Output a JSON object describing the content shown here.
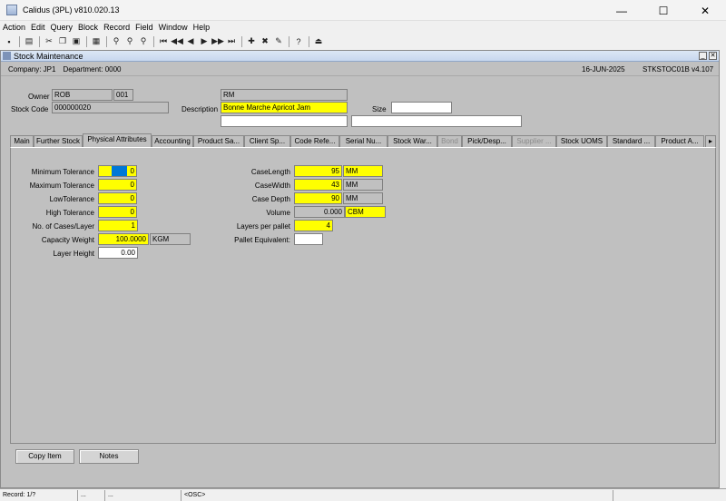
{
  "window": {
    "title": "Calidus (3PL) v810.020.13",
    "minimize": "—",
    "maximize": "☐",
    "close": "✕"
  },
  "menu": [
    "Action",
    "Edit",
    "Query",
    "Block",
    "Record",
    "Field",
    "Window",
    "Help"
  ],
  "form": {
    "title": "Stock Maintenance",
    "company": "Company: JP1",
    "department": "Department: 0000",
    "date": "16-JUN-2025",
    "form_code": "STKSTOC01B  v4.107"
  },
  "header": {
    "owner_label": "Owner",
    "owner_name": "ROB",
    "owner_code": "001",
    "stock_code_label": "Stock Code",
    "stock_code": "000000020",
    "rm": "RM",
    "description_label": "Description",
    "description": "Bonne Marche Apricot Jam",
    "size_label": "Size",
    "size": ""
  },
  "tabs": [
    {
      "label": "Main",
      "state": "normal"
    },
    {
      "label": "Further Stock",
      "state": "normal"
    },
    {
      "label": "Physical Attributes",
      "state": "active"
    },
    {
      "label": "Accounting",
      "state": "normal"
    },
    {
      "label": "Product Sa...",
      "state": "normal"
    },
    {
      "label": "Client Sp...",
      "state": "normal"
    },
    {
      "label": "Code Refe...",
      "state": "normal"
    },
    {
      "label": "Serial Nu...",
      "state": "normal"
    },
    {
      "label": "Stock War...",
      "state": "normal"
    },
    {
      "label": "Bond",
      "state": "disabled"
    },
    {
      "label": "Pick/Desp...",
      "state": "normal"
    },
    {
      "label": "Supplier ...",
      "state": "disabled"
    },
    {
      "label": "Stock UOMS",
      "state": "normal"
    },
    {
      "label": "Standard ...",
      "state": "normal"
    },
    {
      "label": "Product A...",
      "state": "normal"
    }
  ],
  "tab_scroll": "▸",
  "physical": {
    "min_tol_label": "Minimum Tolerance",
    "min_tol": "0",
    "max_tol_label": "Maximum Tolerance",
    "max_tol": "0",
    "low_tol_label": "LowTolerance",
    "low_tol": "0",
    "high_tol_label": "High Tolerance",
    "high_tol": "0",
    "cases_layer_label": "No. of Cases/Layer",
    "cases_layer": "1",
    "cap_weight_label": "Capacity Weight",
    "cap_weight": "100.0000",
    "cap_weight_uom": "KGM",
    "layer_height_label": "Layer Height",
    "layer_height": "0.00",
    "case_length_label": "CaseLength",
    "case_length": "95",
    "case_length_uom": "MM",
    "case_width_label": "CaseWidth",
    "case_width": "43",
    "case_width_uom": "MM",
    "case_depth_label": "Case Depth",
    "case_depth": "90",
    "case_depth_uom": "MM",
    "volume_label": "Volume",
    "volume": "0.000",
    "volume_uom": "CBM",
    "layers_pallet_label": "Layers per pallet",
    "layers_pallet": "4",
    "pallet_equiv_label": "Pallet Equivalent:",
    "pallet_equiv": ""
  },
  "buttons": {
    "copy_item": "Copy Item",
    "notes": "Notes"
  },
  "status": {
    "record": "Record: 1/?",
    "dots": "...",
    "osc": "<OSC>"
  }
}
